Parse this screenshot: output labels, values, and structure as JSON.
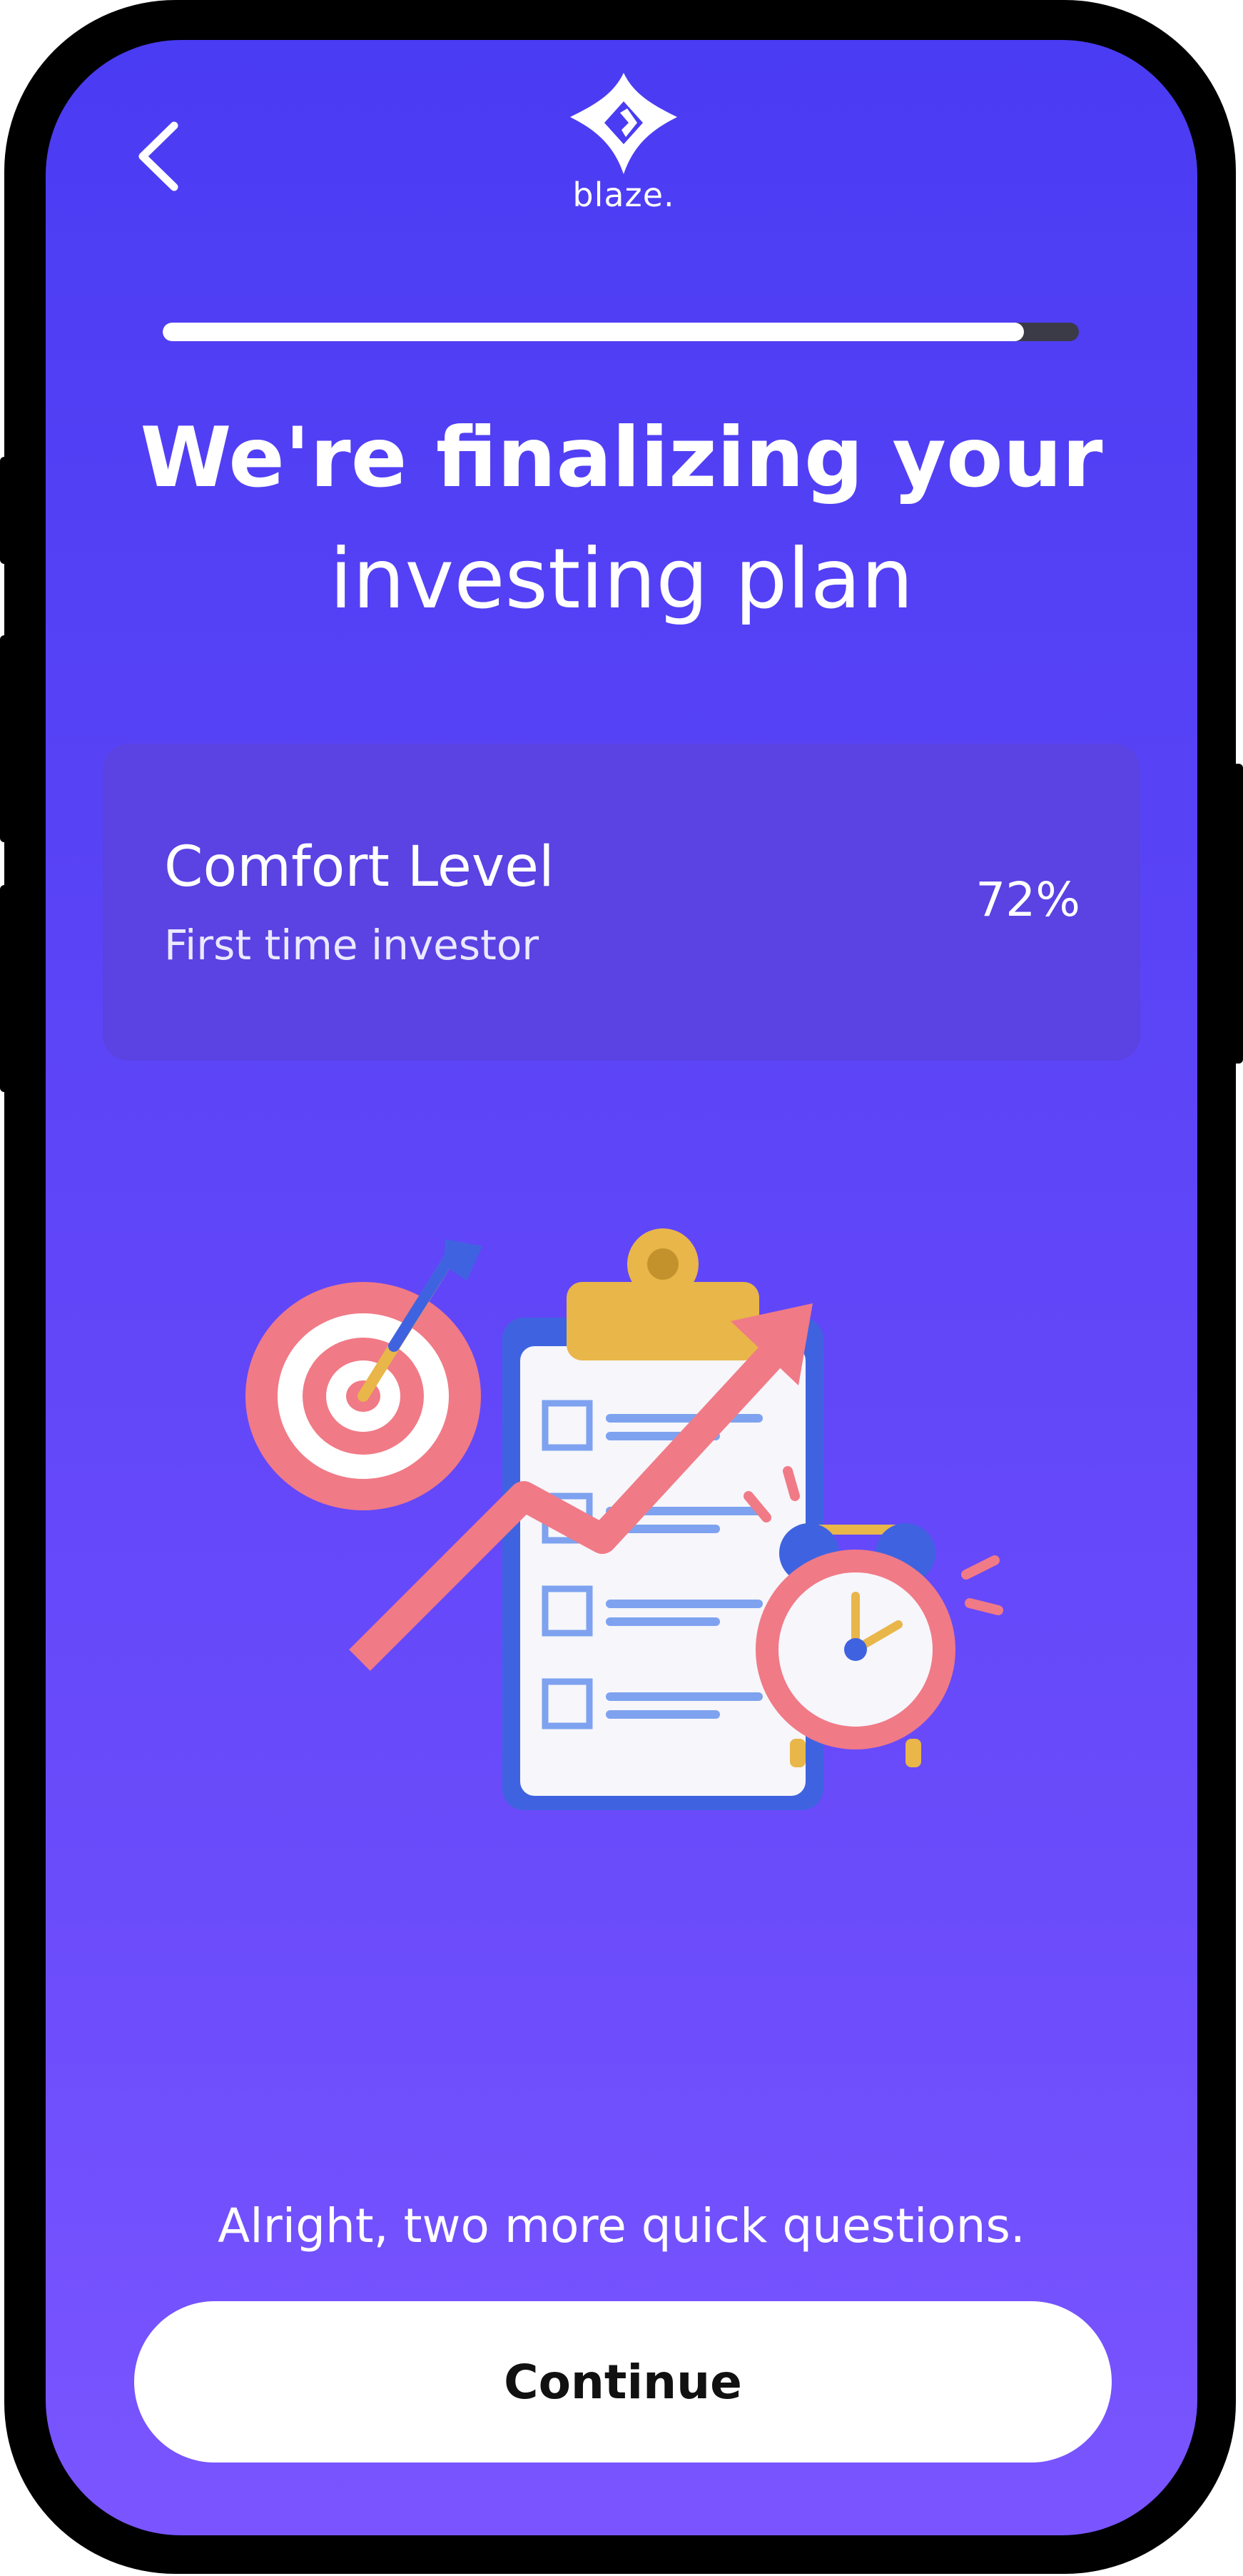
{
  "header": {
    "back_icon": "chevron-left-icon",
    "logo_icon": "blaze-diamond-logo-icon",
    "logo_text": "blaze."
  },
  "progress": {
    "value": 0.94
  },
  "title": {
    "line1": "We're finalizing your",
    "line2": "investing plan"
  },
  "card": {
    "title": "Comfort Level",
    "subtitle": "First time investor",
    "percent": "72%"
  },
  "illustration": {
    "icons": [
      "target-dart-icon",
      "clipboard-checklist-icon",
      "growth-arrow-icon",
      "alarm-clock-icon"
    ]
  },
  "footer": {
    "text": "Alright, two more quick questions.",
    "button_label": "Continue"
  },
  "colors": {
    "background_top": "#4a3cf3",
    "background_bottom": "#7a55ff",
    "card": "#5a42e3",
    "button": "#ffffff",
    "progress_track": "#3b3b48"
  }
}
